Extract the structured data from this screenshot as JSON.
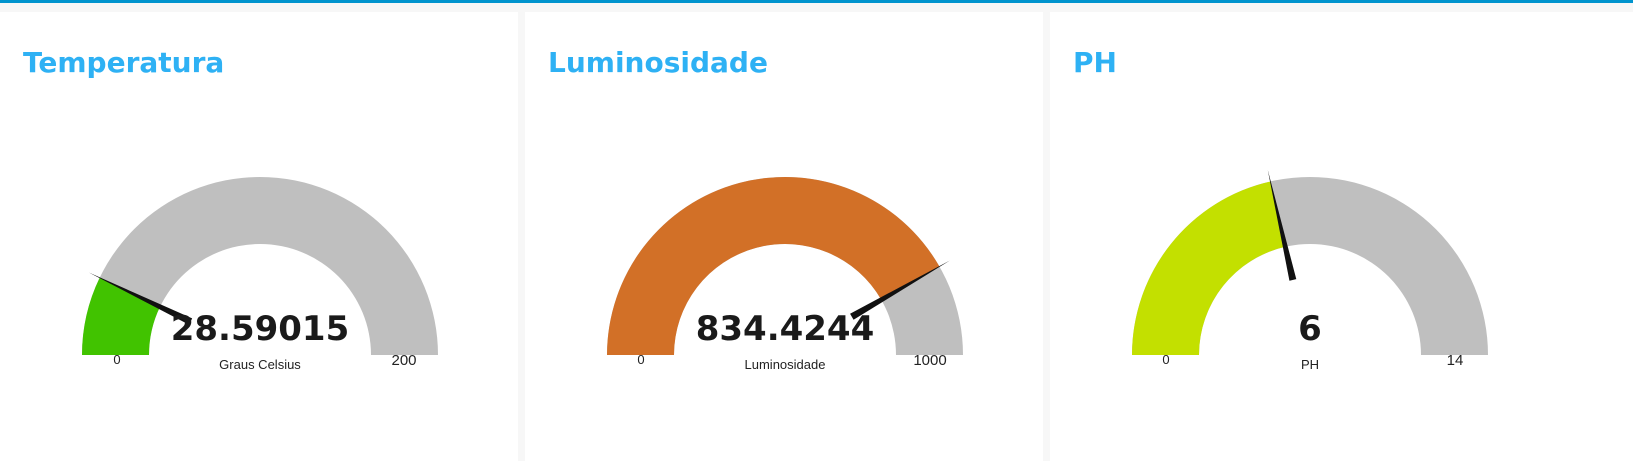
{
  "gauges": [
    {
      "title": "Temperatura",
      "value": "28.59015",
      "numeric_value": 28.59015,
      "unit": "Graus Celsius",
      "min": "0",
      "max": "200",
      "min_value": 0,
      "max_value": 200,
      "fill_color": "#41c300"
    },
    {
      "title": "Luminosidade",
      "value": "834.4244",
      "numeric_value": 834.4244,
      "unit": "Luminosidade",
      "min": "0",
      "max": "1000",
      "min_value": 0,
      "max_value": 1000,
      "fill_color": "#d27027"
    },
    {
      "title": "PH",
      "value": "6",
      "numeric_value": 6,
      "unit": "PH",
      "min": "0",
      "max": "14",
      "min_value": 0,
      "max_value": 14,
      "fill_color": "#c3e000"
    }
  ],
  "colors": {
    "accent_bar": "#0094ce",
    "title": "#2eb1f4",
    "track": "#bfbfbf",
    "needle": "#111111"
  }
}
